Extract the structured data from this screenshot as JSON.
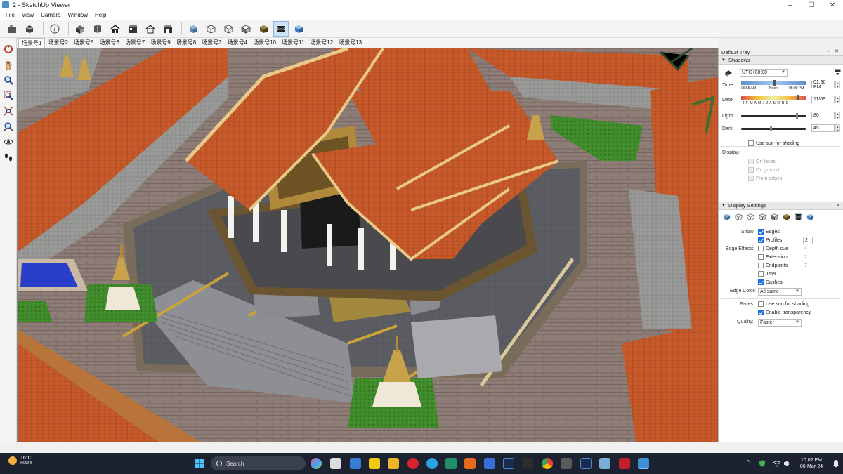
{
  "window": {
    "title": "2 - SketchUp Viewer",
    "controls": [
      "–",
      "☐",
      "✕"
    ]
  },
  "menu": [
    "File",
    "View",
    "Camera",
    "Window",
    "Help"
  ],
  "toolbar": {
    "icons": [
      "open-file-icon",
      "model-info-icon",
      "info-icon",
      "iso-view-icon",
      "top-view-icon",
      "front-view-icon",
      "right-view-icon",
      "back-view-icon",
      "left-view-icon",
      "xray-icon",
      "wireframe-icon",
      "hidden-line-icon",
      "shaded-icon",
      "shaded-textures-icon",
      "monochrome-icon"
    ]
  },
  "scenes": [
    "场景号1",
    "场景号2",
    "场景号5",
    "场景号6",
    "场景号7",
    "场景号9",
    "场景号8",
    "场景号3",
    "场景号4",
    "场景号10",
    "场景号11",
    "场景号12",
    "场景号13"
  ],
  "tray": {
    "title": "Default Tray",
    "shadows": {
      "header": "Shadows",
      "timezone": "UTC+08:00",
      "time_label": "Time",
      "time_start": "06:55 AM",
      "time_noon": "Noon",
      "time_end": "05:00 PM",
      "time_value": "01:30 PM",
      "date_label": "Date",
      "months": "J F M A M J J A S O N D",
      "date_value": "11/08",
      "light_label": "Light",
      "light_value": "80",
      "light_level": 0.85,
      "dark_label": "Dark",
      "dark_value": "45",
      "dark_level": 0.45,
      "use_sun": "Use sun for shading",
      "display_label": "Display:",
      "on_faces": "On faces",
      "on_ground": "On ground",
      "from_edges": "From edges"
    },
    "display": {
      "header": "Display Settings",
      "show_label": "Show:",
      "edges": "Edges",
      "profiles": "Profiles",
      "profiles_value": "2",
      "edge_effects_label": "Edge Effects:",
      "depth_cue": "Depth cue",
      "depth_cue_value": "4",
      "extension": "Extension",
      "extension_value": "2",
      "endpoints": "Endpoints",
      "endpoints_value": "7",
      "jitter": "Jitter",
      "dashes": "Dashes",
      "edge_color_label": "Edge Color:",
      "edge_color_value": "All same",
      "faces_label": "Faces:",
      "faces_use_sun": "Use sun for shading",
      "enable_transparency": "Enable transparency",
      "quality_label": "Quality:",
      "quality_value": "Faster"
    }
  },
  "taskbar": {
    "temperature": "16°C",
    "weather": "Haze",
    "search_placeholder": "Search",
    "time": "10:02 PM",
    "date": "06-Mar-24",
    "sys_up": "^"
  },
  "colors": {
    "roof": "#c85a2a",
    "roof_dark": "#8f3a18",
    "gold": "#c9a23a",
    "paving": "#8d7c76",
    "floor": "#5f6066",
    "grass": "#3f8f2c",
    "pool": "#2a3fc9",
    "accent": "#1e6fd9"
  }
}
